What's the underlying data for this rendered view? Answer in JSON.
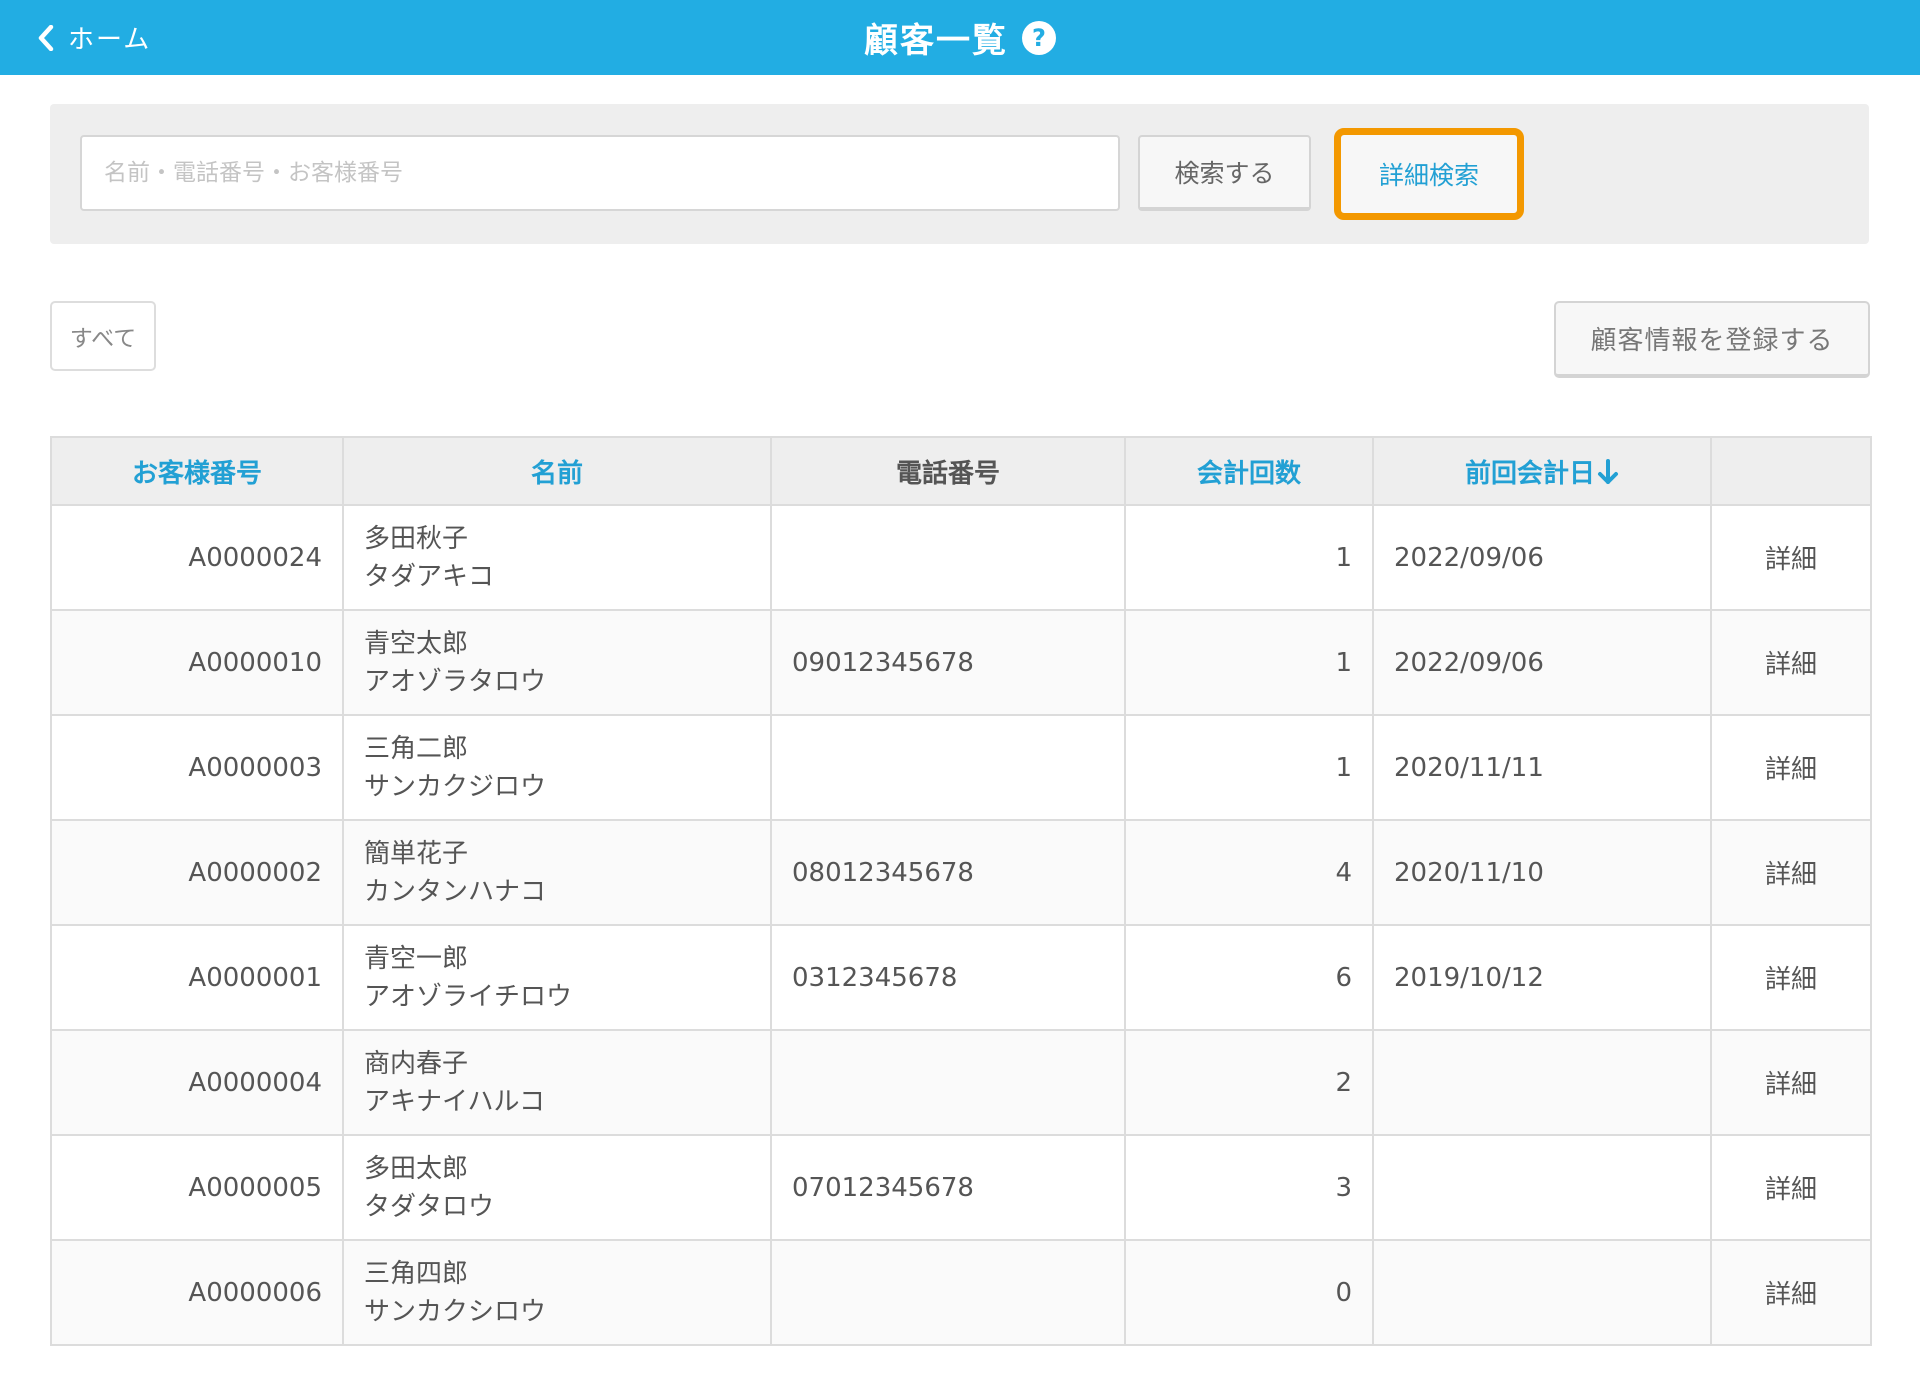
{
  "header": {
    "back_label": "ホーム",
    "title": "顧客一覧",
    "help_glyph": "?"
  },
  "search": {
    "placeholder": "名前・電話番号・お客様番号",
    "value": "",
    "search_button": "検索する",
    "detail_search_button": "詳細検索"
  },
  "filter": {
    "all_label": "すべて"
  },
  "register_button": "顧客情報を登録する",
  "table": {
    "headers": {
      "customer_no": "お客様番号",
      "name": "名前",
      "phone": "電話番号",
      "visits": "会計回数",
      "last_date": "前回会計日"
    },
    "sort": {
      "column": "last_date",
      "direction": "desc"
    },
    "detail_label": "詳細",
    "rows": [
      {
        "no": "A0000024",
        "name": "多田秋子",
        "kana": "タダアキコ",
        "phone": "",
        "count": "1",
        "date": "2022/09/06"
      },
      {
        "no": "A0000010",
        "name": "青空太郎",
        "kana": "アオゾラタロウ",
        "phone": "09012345678",
        "count": "1",
        "date": "2022/09/06"
      },
      {
        "no": "A0000003",
        "name": "三角二郎",
        "kana": "サンカクジロウ",
        "phone": "",
        "count": "1",
        "date": "2020/11/11"
      },
      {
        "no": "A0000002",
        "name": "簡単花子",
        "kana": "カンタンハナコ",
        "phone": "08012345678",
        "count": "4",
        "date": "2020/11/10"
      },
      {
        "no": "A0000001",
        "name": "青空一郎",
        "kana": "アオゾライチロウ",
        "phone": "0312345678",
        "count": "6",
        "date": "2019/10/12"
      },
      {
        "no": "A0000004",
        "name": "商内春子",
        "kana": "アキナイハルコ",
        "phone": "",
        "count": "2",
        "date": ""
      },
      {
        "no": "A0000005",
        "name": "多田太郎",
        "kana": "タダタロウ",
        "phone": "07012345678",
        "count": "3",
        "date": ""
      },
      {
        "no": "A0000006",
        "name": "三角四郎",
        "kana": "サンカクシロウ",
        "phone": "",
        "count": "0",
        "date": ""
      }
    ]
  },
  "colors": {
    "header_bg": "#22ade3",
    "link": "#22a0d4",
    "highlight_border": "#f39800"
  },
  "icons": {
    "back": "chevron-left-icon",
    "help": "help-icon",
    "sort": "arrow-down-icon"
  }
}
